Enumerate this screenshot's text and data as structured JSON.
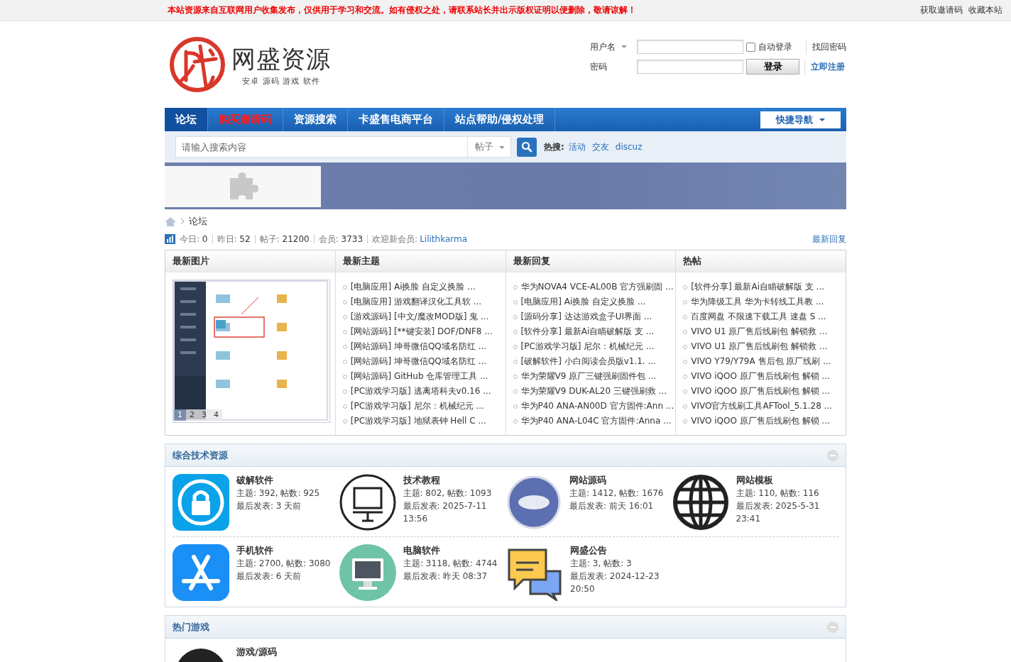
{
  "notice": "本站资源来自互联网用户收集发布，仅供用于学习和交流。如有侵权之处，请联系站长并出示版权证明以便删除，敬请谅解！",
  "top_links": [
    "获取邀请码",
    "收藏本站"
  ],
  "logo": {
    "title": "网盛资源",
    "subtitle": "安卓 源码 游戏 软件"
  },
  "login": {
    "username_label": "用户名",
    "password_label": "密码",
    "auto_login": "自动登录",
    "auto_checked": false,
    "login_button": "登录",
    "forgot": "找回密码",
    "register": "立即注册"
  },
  "nav": [
    {
      "label": "论坛",
      "selected": true,
      "kind": "normal"
    },
    {
      "label": "购买邀请码",
      "selected": false,
      "kind": "highlight"
    },
    {
      "label": "资源搜索",
      "selected": false,
      "kind": "normal"
    },
    {
      "label": "卡盛售电商平台",
      "selected": false,
      "kind": "normal"
    },
    {
      "label": "站点帮助/侵权处理",
      "selected": false,
      "kind": "normal"
    }
  ],
  "quick_nav": "快捷导航",
  "search": {
    "placeholder": "请输入搜索内容",
    "type": "帖子",
    "hot_label": "热搜:",
    "hot": [
      "活动",
      "交友",
      "discuz"
    ]
  },
  "breadcrumb": [
    "论坛"
  ],
  "stats": [
    {
      "label": "今日:",
      "value": "0"
    },
    {
      "label": "昨日:",
      "value": "52"
    },
    {
      "label": "帖子:",
      "value": "21200"
    },
    {
      "label": "会员:",
      "value": "3733"
    }
  ],
  "welcome": {
    "label": "欢迎新会员:",
    "name": "Lilithkarma"
  },
  "latest_reply_link": "最新回复",
  "panels": {
    "images_title": "最新图片",
    "pager": [
      {
        "label": "1",
        "selected": true
      },
      {
        "label": "2",
        "selected": false
      },
      {
        "label": "3",
        "selected": false
      },
      {
        "label": "4",
        "selected": false
      }
    ],
    "lists": [
      {
        "title": "最新主题",
        "items": [
          "[电脑应用] Ai换脸 自定义换脸 ...",
          "[电脑应用] 游戏翻译汉化工具软 ...",
          "[游戏源码] [中文/魔改MOD版] 鬼 ...",
          "[网站源码] [**键安装] DOF/DNF8 ...",
          "[网站源码] 坤哥微信QQ域名防红 ...",
          "[网站源码] 坤哥微信QQ域名防红 ...",
          "[网站源码] GitHub 仓库管理工具 ...",
          "[PC游戏学习版] 逃离塔科夫v0.16 ...",
          "[PC游戏学习版] 尼尔：机械纪元 ...",
          "[PC游戏学习版] 地狱表钟 Hell C ..."
        ]
      },
      {
        "title": "最新回复",
        "items": [
          "华为NOVA4 VCE-AL00B 官方强刷固 ...",
          "[电脑应用] Ai换脸 自定义换脸 ...",
          "[源码分享] 达达游戏盒子UI界面 ...",
          "[软件分享] 最新Ai自瞄破解版 支 ...",
          "[PC游戏学习版] 尼尔：机械纪元 ...",
          "[破解软件] 小白阅读会员版v1.1. ...",
          "华为荣耀V9 原厂三键强刷固件包 ...",
          "华为荣耀V9 DUK-AL20 三键强刷救 ...",
          "华为P40 ANA-AN00D 官方固件:Ann ...",
          "华为P40 ANA-L04C 官方固件:Anna ..."
        ]
      },
      {
        "title": "热帖",
        "items": [
          "[软件分享] 最新Ai自瞄破解版 支 ...",
          "华为降级工具 华为卡转线工具教 ...",
          "百度网盘 不限速下载工具 速盘 S ...",
          "VIVO U1 原厂售后线刷包 解锁救 ...",
          "VIVO U1 原厂售后线刷包 解锁救 ...",
          "VIVO Y79/Y79A 售后包 原厂线刷 ...",
          "VIVO iQOO 原厂售后线刷包 解锁 ...",
          "VIVO iQOO 原厂售后线刷包 解锁 ...",
          "VIVO官方线刷工具AFTool_5.1.28 ...",
          "VIVO iQOO 原厂售后线刷包 解锁 ..."
        ]
      }
    ]
  },
  "sections": [
    {
      "title": "综合技术资源",
      "forums": [
        {
          "name": "破解软件",
          "counts": "主题: 392, 帖数: 925",
          "last": "最后发表: 3 天前"
        },
        {
          "name": "技术教程",
          "counts": "主题: 802, 帖数: 1093",
          "last": "最后发表: 2025-7-11 13:56"
        },
        {
          "name": "网站源码",
          "counts": "主题: 1412, 帖数: 1676",
          "last": "最后发表: 前天 16:01"
        },
        {
          "name": "网站模板",
          "counts": "主题: 110, 帖数: 116",
          "last": "最后发表: 2025-5-31 23:41"
        },
        {
          "name": "手机软件",
          "counts": "主题: 2700, 帖数: 3080",
          "last": "最后发表: 6 天前"
        },
        {
          "name": "电脑软件",
          "counts": "主题: 3118, 帖数: 4744",
          "last": "最后发表: 昨天 08:37"
        },
        {
          "name": "网盛公告",
          "counts": "主题: 3, 帖数: 3",
          "last": "最后发表: 2024-12-23 20:50"
        }
      ]
    },
    {
      "title": "热门游戏",
      "forums": [
        {
          "name": "游戏/源码"
        }
      ]
    }
  ]
}
